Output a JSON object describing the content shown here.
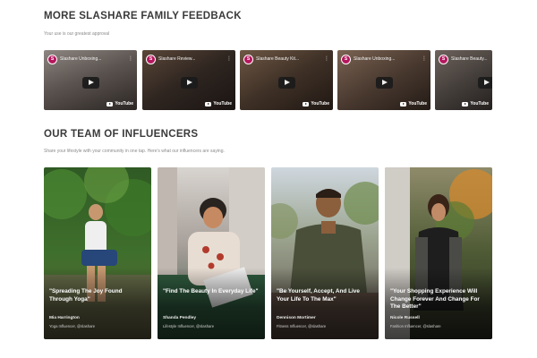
{
  "feedback": {
    "title": "MORE SLASHARE FAMILY FEEDBACK",
    "subtitle": "Your use is our greatest approval",
    "videos": [
      {
        "title": "Slashare Unboxing...",
        "platform": "YouTube",
        "color": "#6b6460"
      },
      {
        "title": "Slashare Review...",
        "platform": "YouTube",
        "color": "#3a302a"
      },
      {
        "title": "Slashare Beauty Kit...",
        "platform": "YouTube",
        "color": "#4a3a2e"
      },
      {
        "title": "Slashare Unboxing...",
        "platform": "YouTube",
        "color": "#5a4a3e"
      },
      {
        "title": "Slashare Beauty...",
        "platform": "YouTube",
        "color": "#4e4440"
      }
    ]
  },
  "team": {
    "title": "OUR TEAM OF INFLUENCERS",
    "subtitle": "Share your lifestyle with your community in one tap. Here's what our influencers are saying.",
    "influencers": [
      {
        "quote": "\"Spreading The Joy Found Through Yoga\"",
        "name": "Mia Harrington",
        "role": "Yoga Influencer, @slashare"
      },
      {
        "quote": "\"Find The Beauty In Everyday Life\"",
        "name": "Shanda Pendley",
        "role": "Lifestyle Influencer, @slashare"
      },
      {
        "quote": "\"Be Yourself, Accept, And Live Your Life To The Max\"",
        "name": "Dennison Mortimer",
        "role": "Fitness Influencer, @slashare"
      },
      {
        "quote": "\"Your Shopping Experience Will Change Forever And Change For The Better\"",
        "name": "Nicole Russell",
        "role": "Fashion Influencer, @slashare"
      }
    ]
  }
}
